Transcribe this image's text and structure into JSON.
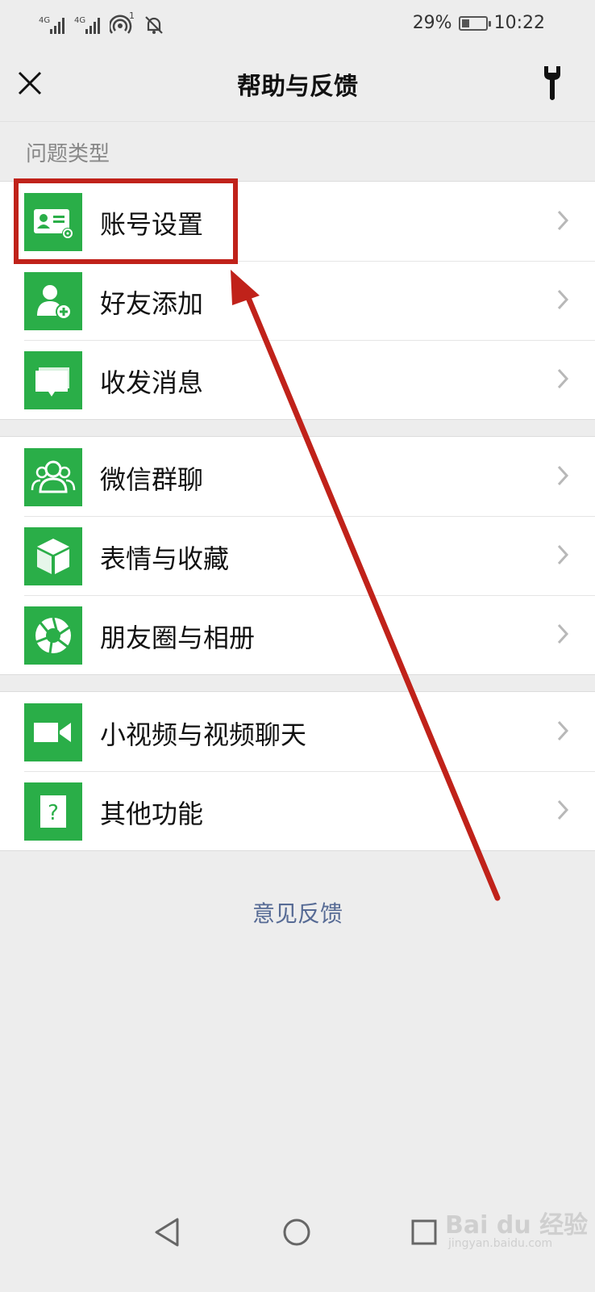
{
  "status_bar": {
    "sig1": "4G",
    "sig2": "4G",
    "notif_count": "1",
    "battery": "29%",
    "time": "10:22"
  },
  "header": {
    "title": "帮助与反馈"
  },
  "section": {
    "label": "问题类型"
  },
  "groups": [
    {
      "items": [
        {
          "label": "账号设置",
          "icon": "id-card-gear-icon"
        },
        {
          "label": "好友添加",
          "icon": "add-friend-icon"
        },
        {
          "label": "收发消息",
          "icon": "message-bubble-icon"
        }
      ]
    },
    {
      "items": [
        {
          "label": "微信群聊",
          "icon": "group-people-icon"
        },
        {
          "label": "表情与收藏",
          "icon": "cube-icon"
        },
        {
          "label": "朋友圈与相册",
          "icon": "aperture-icon"
        }
      ]
    },
    {
      "items": [
        {
          "label": "小视频与视频聊天",
          "icon": "video-camera-icon"
        },
        {
          "label": "其他功能",
          "icon": "question-icon"
        }
      ]
    }
  ],
  "footer": {
    "feedback_link": "意见反馈"
  },
  "watermark": {
    "main": "Bai du 经验",
    "sub": "jingyan.baidu.com"
  },
  "colors": {
    "accent_green": "#2aae48",
    "link_blue": "#576b95",
    "annotation_red": "#c0221a"
  }
}
